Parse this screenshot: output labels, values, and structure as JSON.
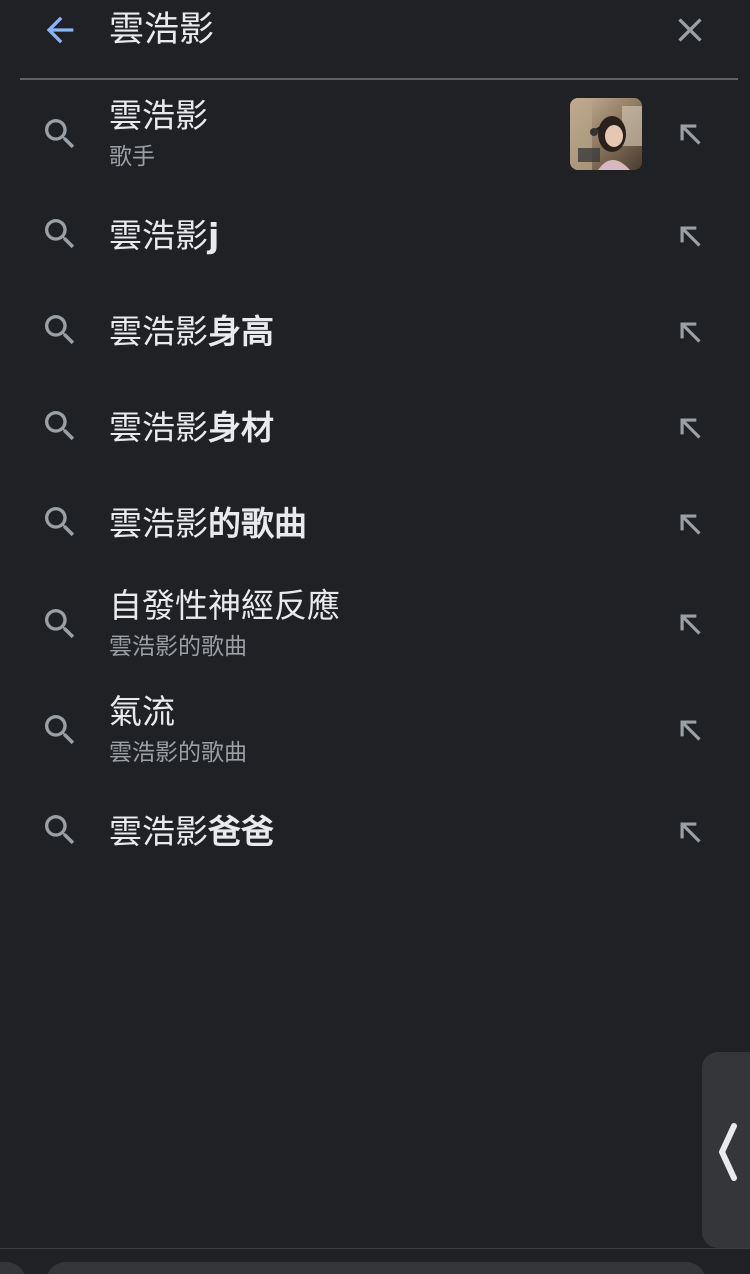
{
  "search": {
    "query": "雲浩影"
  },
  "suggestions": [
    {
      "typed": "雲浩影",
      "completion": "",
      "subtitle": "歌手",
      "has_thumbnail": true
    },
    {
      "typed": "雲浩影",
      "completion": "j",
      "subtitle": ""
    },
    {
      "typed": "雲浩影",
      "completion": "身高",
      "subtitle": ""
    },
    {
      "typed": "雲浩影",
      "completion": "身材",
      "subtitle": ""
    },
    {
      "typed": "雲浩影",
      "completion": "的歌曲",
      "subtitle": ""
    },
    {
      "typed": "自發性神經反應",
      "completion": "",
      "subtitle": "雲浩影的歌曲"
    },
    {
      "typed": "氣流",
      "completion": "",
      "subtitle": "雲浩影的歌曲"
    },
    {
      "typed": "雲浩影",
      "completion": "爸爸",
      "subtitle": ""
    }
  ],
  "icons": {
    "back": "arrow-left-icon",
    "clear": "close-icon",
    "search": "search-icon",
    "fill": "arrow-up-left-icon",
    "edge": "chevron-left-icon"
  },
  "colors": {
    "background": "#202124",
    "accent": "#8ab4f8",
    "text": "#e8eaed",
    "secondary_text": "#9aa0a6",
    "icon": "#9aa0a6"
  }
}
